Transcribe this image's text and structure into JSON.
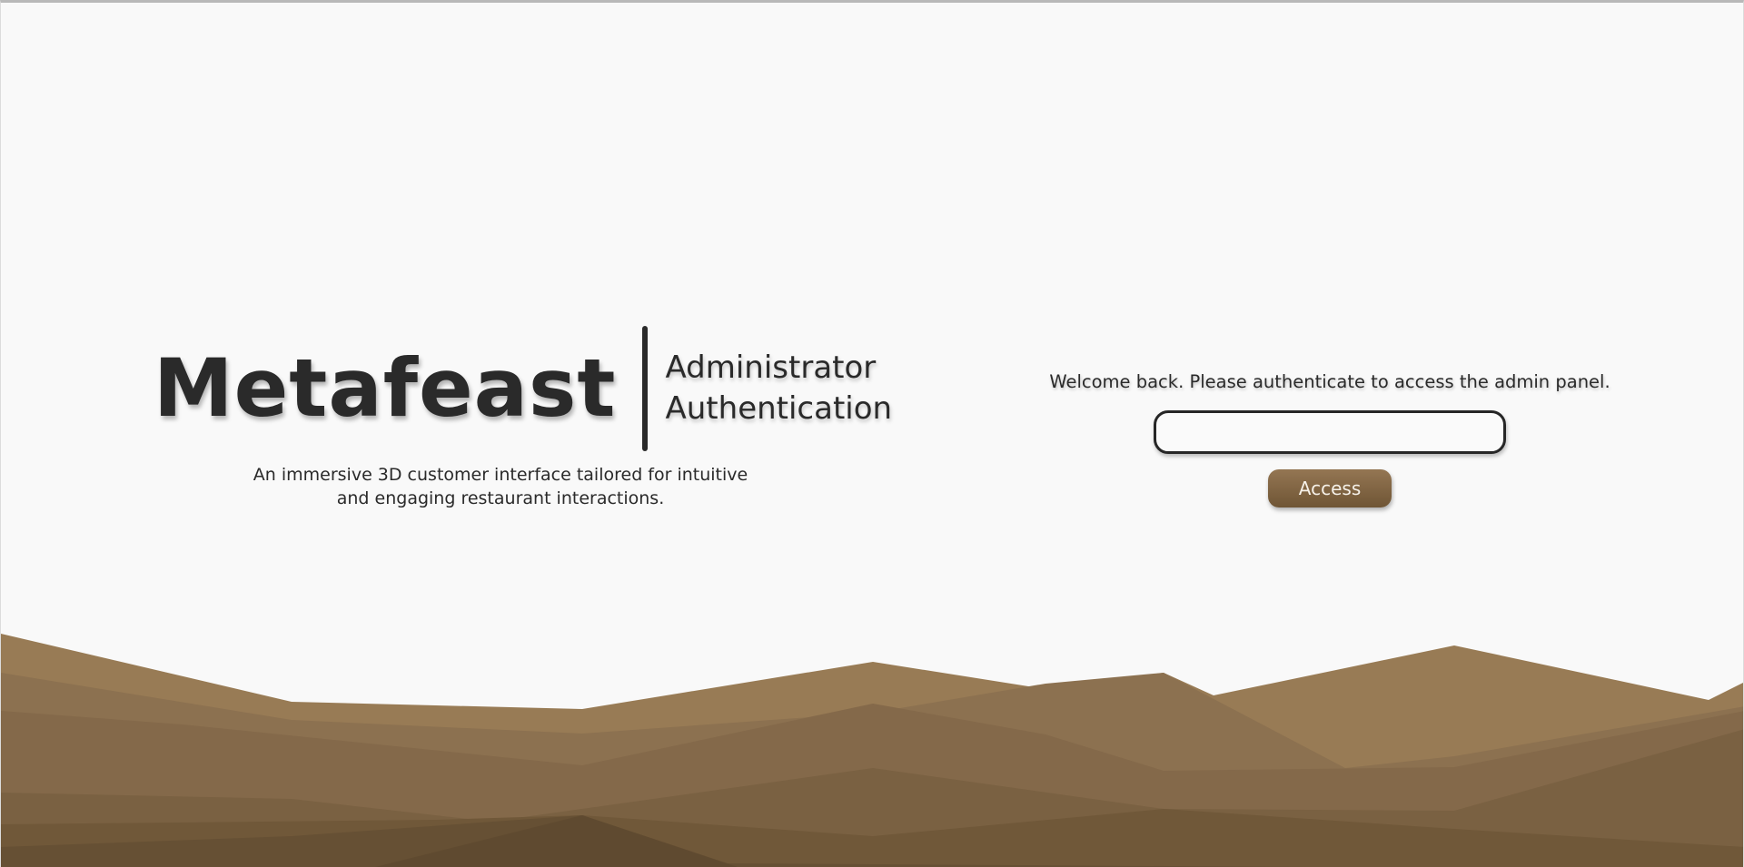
{
  "brand": {
    "name": "Metafeast",
    "subtitle_line1": "Administrator",
    "subtitle_line2": "Authentication",
    "tagline_line1": "An immersive 3D customer interface tailored for intuitive",
    "tagline_line2": "and engaging restaurant interactions."
  },
  "login": {
    "welcome": "Welcome back. Please authenticate to access the admin panel.",
    "input_value": "",
    "access_label": "Access"
  },
  "colors": {
    "background": "#f9f9f9",
    "text": "#2a2a2a",
    "accent": "#85694a"
  }
}
